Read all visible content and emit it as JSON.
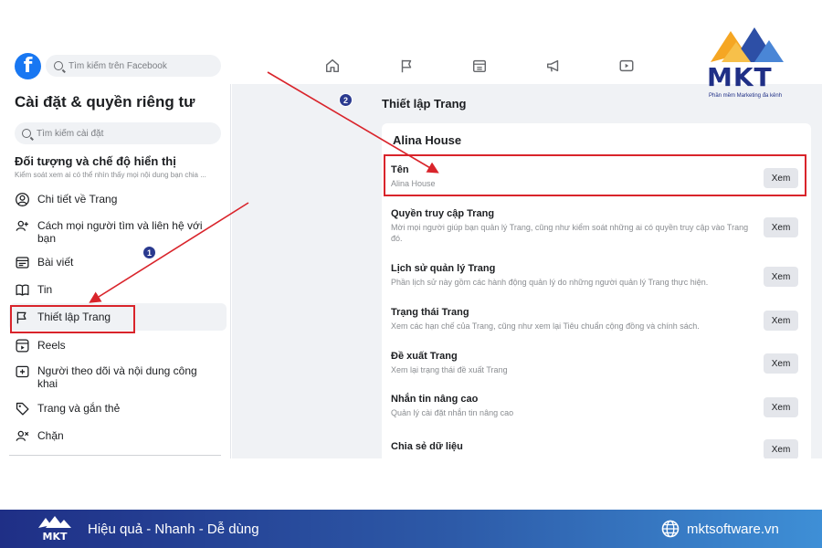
{
  "topbar": {
    "logo_letter": "f",
    "search_placeholder": "Tìm kiếm trên Facebook",
    "nav_icons": [
      "home-icon",
      "flag-icon",
      "marketplace-icon",
      "megaphone-icon",
      "video-icon"
    ]
  },
  "sidebar": {
    "title": "Cài đặt & quyền riêng tư",
    "search_placeholder": "Tìm kiếm cài đặt",
    "section_title": "Đối tượng và chế độ hiển thị",
    "section_subtitle": "Kiểm soát xem ai có thể nhìn thấy mọi nội dung bạn chia ...",
    "items": [
      {
        "label": "Chi tiết về Trang",
        "icon": "person-circle-icon"
      },
      {
        "label": "Cách mọi người tìm và liên hệ với bạn",
        "icon": "person-add-icon"
      },
      {
        "label": "Bài viết",
        "icon": "post-icon"
      },
      {
        "label": "Tin",
        "icon": "book-icon"
      },
      {
        "label": "Thiết lập Trang",
        "icon": "flag-icon"
      },
      {
        "label": "Reels",
        "icon": "reels-icon"
      },
      {
        "label": "Người theo dõi và nội dung công khai",
        "icon": "add-box-icon"
      },
      {
        "label": "Trang và gắn thẻ",
        "icon": "tag-icon"
      },
      {
        "label": "Chặn",
        "icon": "person-block-icon"
      }
    ]
  },
  "main": {
    "title": "Thiết lập Trang",
    "card_title": "Alina House",
    "view_label": "Xem",
    "rows": [
      {
        "title": "Tên",
        "desc": "Alina House"
      },
      {
        "title": "Quyền truy cập Trang",
        "desc": "Mời mọi người giúp bạn quản lý Trang, cũng như kiểm soát những ai có quyền truy cập vào Trang đó."
      },
      {
        "title": "Lịch sử quản lý Trang",
        "desc": "Phần lịch sử này gồm các hành động quản lý do những người quản lý Trang thực hiện."
      },
      {
        "title": "Trạng thái Trang",
        "desc": "Xem các hạn chế của Trang, cũng như xem lại Tiêu chuẩn cộng đồng và chính sách."
      },
      {
        "title": "Đề xuất Trang",
        "desc": "Xem lại trạng thái đề xuất Trang"
      },
      {
        "title": "Nhắn tin nâng cao",
        "desc": "Quản lý cài đặt nhắn tin nâng cao"
      },
      {
        "title": "Chia sẻ dữ liệu",
        "desc": ""
      }
    ]
  },
  "annotations": {
    "step1": "1",
    "step2": "2",
    "color": "#d9242b"
  },
  "brand": {
    "logo_text": "MKT",
    "tagline": "Phần mềm Marketing đa kênh",
    "slogan": "Hiệu quả - Nhanh - Dễ dùng",
    "website": "mktsoftware.vn",
    "primary_color": "#1f2f86",
    "accent_color": "#f5a623"
  }
}
